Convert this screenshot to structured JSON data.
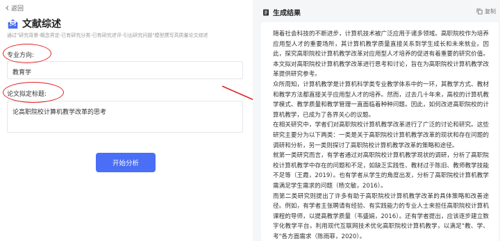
{
  "nav": {
    "back_label": "返回"
  },
  "header": {
    "title": "文献综述",
    "subtitle": "通过\"研究背景-概念界定-已有研究分类-已有研究述评-引出研究问题\"模型撰写高质量论文综述"
  },
  "form": {
    "field1_label": "专业方向:",
    "field1_value": "教育学",
    "field2_label": "论文拟定标题:",
    "field2_value": "论高职院校计算机教学改革的思考",
    "submit_label": "开始分析"
  },
  "result": {
    "title": "生成结果",
    "copy_label": "复制",
    "paragraphs": [
      "随着社会科技的不断进步，计算机技术被广泛应用于诸多领域。高职院校作为培养应用型人才的重要场所，其计算机教学质量直接关系到学生成长和未来就业。因此，探究高职院校计算机教学改革对应用型人才培养的促进有着重要的研究价值。本文拟对高职院校计算机教学改革进行思考和讨论，旨在为高职院校计算机教学改革提供研究参考。",
      "众所周知，计算机教学是计算机科学类专业教学体系中的一环，其教学方式、教材和教学方法都直接关乎应用型人才的培养。然而，过去几十年来，高校的计算机教学模式、教学质量和教学管理一直面临着种种问题。因此，如何改进高职院校的计算机教学，已成为了各界关心的议题。",
      "在相关研究中，学者们对高职院校计算机教学改革进行了广泛的讨论和研究。这些研究主要分为以下两类：一类是关于高职院校计算机教学改革的现状和存在问题的调研和分析，另一类则探讨了高职院校计算机教学改革的策略和途径。",
      "就第一类研究而言，有学者通过对高职院校计算机教学现状的调研，分析了高职院校计算机教学中存在的问题和不足，如缺乏实践性、教材过于陈旧、教师教学技能不足等（王霞，2019）。也有学者从学生的角度出发，分析了高职院校计算机教学需满足学生需求的问题（杨文敏，2016）。",
      "而第二类研究则提出了许多有助于高职院校计算机教学改革的具体策略和改善途径。例如，有学者主张聘请有经验、有实践能力的专业人士来担任高职院校计算机课程的导师，以提高教学质量（韦盛娟，2016）。还有学者提出，应该逐步建立数字化教学平台，利用现代互联网技术优化高职院校计算机教学，以满足\"教、学、考\"各方面需求（陈雨菲，2020）。"
    ]
  },
  "colors": {
    "accent": "#4a6ef5",
    "annotation": "#e02020",
    "panel_bg": "#f5f6f8"
  }
}
